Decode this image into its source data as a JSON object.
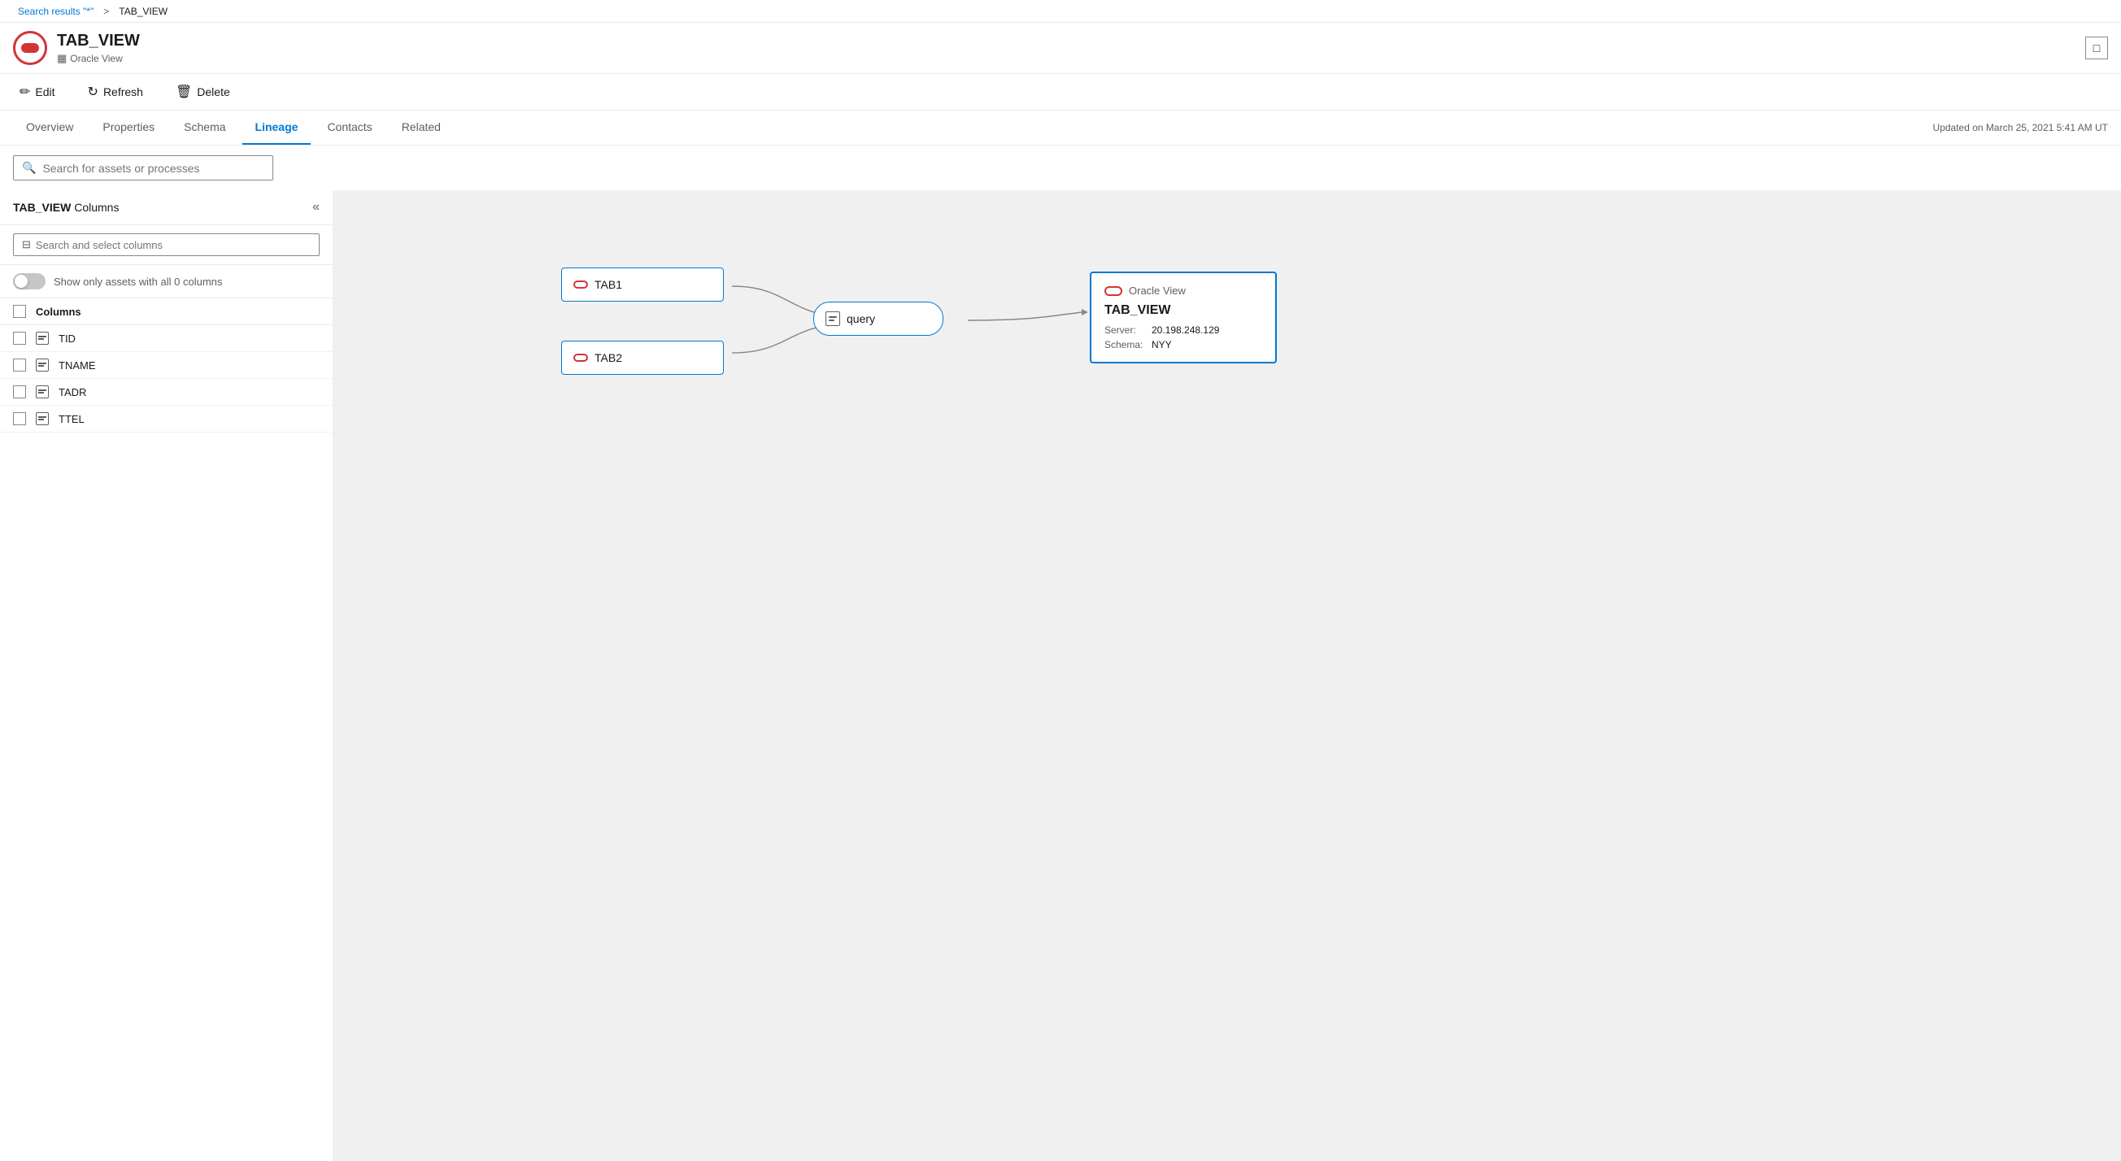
{
  "breadcrumb": {
    "search_label": "Search results \"*\"",
    "separator": ">",
    "current": "TAB_VIEW"
  },
  "header": {
    "title": "TAB_VIEW",
    "subtitle": "Oracle View",
    "subtitle_icon": "table-icon",
    "expand_label": "□"
  },
  "toolbar": {
    "edit_label": "Edit",
    "refresh_label": "Refresh",
    "delete_label": "Delete"
  },
  "tabs": [
    {
      "label": "Overview",
      "active": false
    },
    {
      "label": "Properties",
      "active": false
    },
    {
      "label": "Schema",
      "active": false
    },
    {
      "label": "Lineage",
      "active": true
    },
    {
      "label": "Contacts",
      "active": false
    },
    {
      "label": "Related",
      "active": false
    }
  ],
  "updated_text": "Updated on March 25, 2021 5:41 AM UT",
  "search_bar": {
    "placeholder": "Search for assets or processes"
  },
  "left_panel": {
    "title_bold": "TAB_VIEW",
    "title_suffix": " Columns",
    "column_search_placeholder": "Search and select columns",
    "toggle_label": "Show only assets with all 0 columns",
    "columns_header": "Columns",
    "columns": [
      {
        "name": "TID"
      },
      {
        "name": "TNAME"
      },
      {
        "name": "TADR"
      },
      {
        "name": "TTEL"
      }
    ]
  },
  "lineage": {
    "node_tab1": "TAB1",
    "node_tab2": "TAB2",
    "node_query": "query",
    "detail": {
      "type": "Oracle View",
      "name": "TAB_VIEW",
      "server_label": "Server:",
      "server_value": "20.198.248.129",
      "schema_label": "Schema:",
      "schema_value": "NYY"
    }
  },
  "colors": {
    "accent_blue": "#0078d4",
    "accent_red": "#d13438",
    "border": "#edebe9",
    "bg_canvas": "#f0f0f0"
  }
}
